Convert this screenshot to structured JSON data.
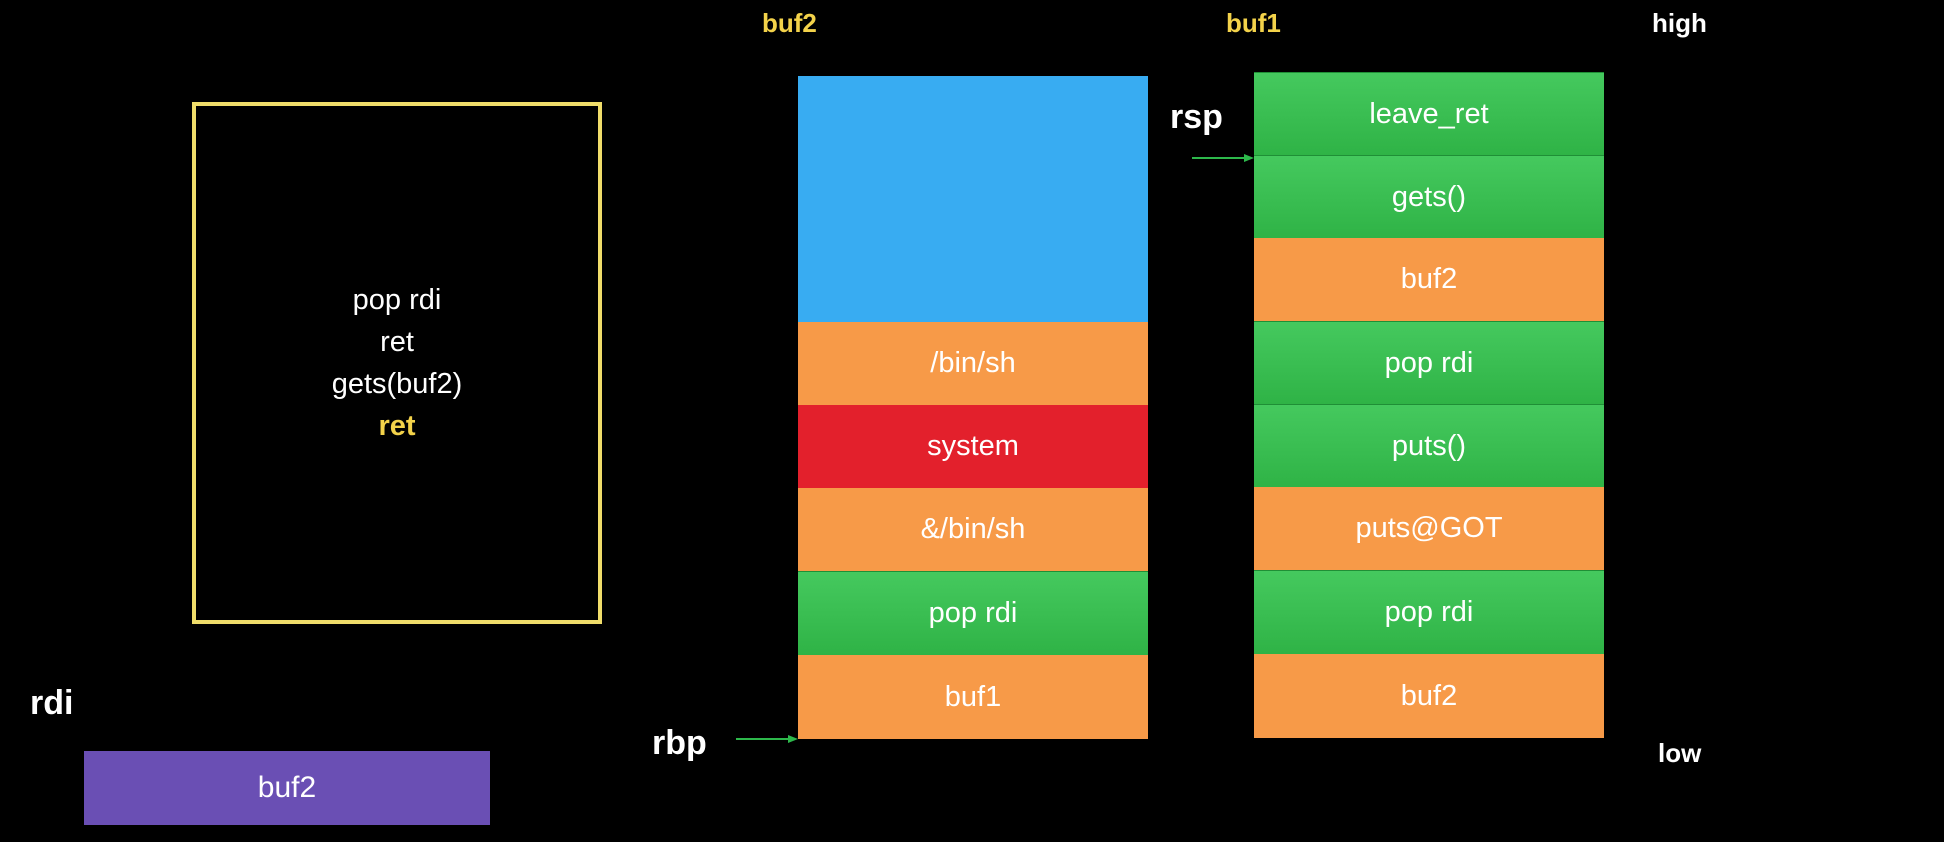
{
  "labels": {
    "buf2": "buf2",
    "buf1": "buf1",
    "high": "high",
    "low": "low",
    "rsp": "rsp",
    "rbp": "rbp",
    "rdi": "rdi"
  },
  "code_box": {
    "lines": [
      "pop rdi",
      "ret",
      "gets(buf2)",
      "ret"
    ]
  },
  "buf2_stack": [
    {
      "text": "",
      "kind": "blue"
    },
    {
      "text": "/bin/sh",
      "kind": "orange"
    },
    {
      "text": "system",
      "kind": "red"
    },
    {
      "text": "&/bin/sh",
      "kind": "orange"
    },
    {
      "text": "pop rdi",
      "kind": "green"
    },
    {
      "text": "buf1",
      "kind": "orange"
    }
  ],
  "buf1_stack": [
    {
      "text": "leave_ret",
      "kind": "green"
    },
    {
      "text": "gets()",
      "kind": "green"
    },
    {
      "text": "buf2",
      "kind": "orange"
    },
    {
      "text": "pop rdi",
      "kind": "green"
    },
    {
      "text": "puts()",
      "kind": "green"
    },
    {
      "text": "puts@GOT",
      "kind": "orange"
    },
    {
      "text": "pop rdi",
      "kind": "green"
    },
    {
      "text": "buf2",
      "kind": "orange"
    }
  ],
  "rdi_register": {
    "value": "buf2"
  },
  "colors": {
    "green": "#3cbf55",
    "orange": "#f79a48",
    "red": "#e3202c",
    "blue": "#38acf2",
    "purple": "#6a4fb4",
    "yellow": "#f3d24a"
  }
}
